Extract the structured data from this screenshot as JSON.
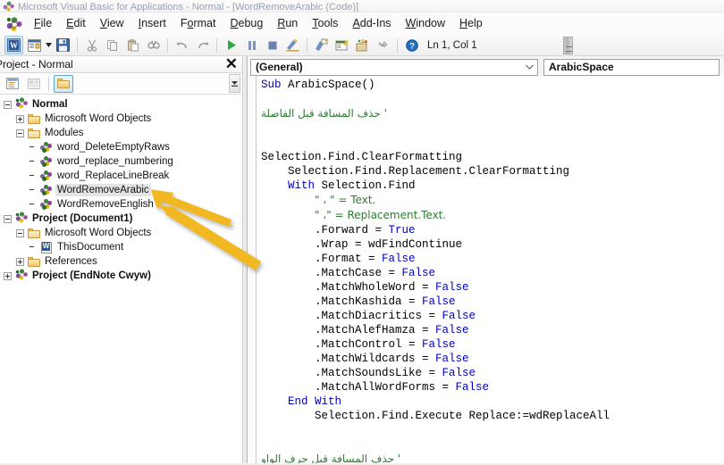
{
  "window": {
    "title": "Microsoft Visual Basic for Applications - Normal - [WordRemoveArabic (Code)]",
    "app_icon": "vba-logo-icon"
  },
  "menubar": {
    "items": [
      {
        "label": "File",
        "mnemonic": "F"
      },
      {
        "label": "Edit",
        "mnemonic": "E"
      },
      {
        "label": "View",
        "mnemonic": "V"
      },
      {
        "label": "Insert",
        "mnemonic": "I"
      },
      {
        "label": "Format",
        "mnemonic": "o"
      },
      {
        "label": "Debug",
        "mnemonic": "D"
      },
      {
        "label": "Run",
        "mnemonic": "R"
      },
      {
        "label": "Tools",
        "mnemonic": "T"
      },
      {
        "label": "Add-Ins",
        "mnemonic": "A"
      },
      {
        "label": "Window",
        "mnemonic": "W"
      },
      {
        "label": "Help",
        "mnemonic": "H"
      }
    ]
  },
  "toolbar": {
    "buttons": [
      "view-word-icon",
      "insert-userform-icon",
      "insert-dropdown-caret-icon",
      "save-icon",
      "cut-icon",
      "copy-icon",
      "paste-icon",
      "find-icon",
      "undo-icon",
      "redo-icon",
      "run-icon",
      "pause-icon",
      "stop-icon",
      "design-mode-icon",
      "project-explorer-icon",
      "properties-window-icon",
      "object-browser-icon",
      "toolbox-icon",
      "help-icon"
    ],
    "status_text": "Ln 1, Col 1"
  },
  "project_explorer": {
    "title": "Project - Normal",
    "close_label": "✕",
    "toolbar_buttons": [
      "view-code-icon",
      "view-object-icon",
      "toggle-folders-icon"
    ],
    "tree": [
      {
        "label": "Normal",
        "icon": "project-icon",
        "depth": 0,
        "bold": true,
        "expander": "minus",
        "selected": false
      },
      {
        "label": "Microsoft Word Objects",
        "icon": "folder-icon",
        "depth": 1,
        "bold": false,
        "expander": "plus",
        "selected": false
      },
      {
        "label": "Modules",
        "icon": "folder-open-icon",
        "depth": 1,
        "bold": false,
        "expander": "minus",
        "selected": false
      },
      {
        "label": "word_DeleteEmptyRaws",
        "icon": "module-icon",
        "depth": 2,
        "bold": false,
        "expander": "none",
        "selected": false
      },
      {
        "label": "word_replace_numbering",
        "icon": "module-icon",
        "depth": 2,
        "bold": false,
        "expander": "none",
        "selected": false
      },
      {
        "label": "word_ReplaceLineBreak",
        "icon": "module-icon",
        "depth": 2,
        "bold": false,
        "expander": "none",
        "selected": false
      },
      {
        "label": "WordRemoveArabic",
        "icon": "module-icon",
        "depth": 2,
        "bold": false,
        "expander": "none",
        "selected": true
      },
      {
        "label": "WordRemoveEnglish",
        "icon": "module-icon",
        "depth": 2,
        "bold": false,
        "expander": "none",
        "selected": false
      },
      {
        "label": "Project (Document1)",
        "icon": "project-icon",
        "depth": 0,
        "bold": true,
        "expander": "minus",
        "selected": false
      },
      {
        "label": "Microsoft Word Objects",
        "icon": "folder-open-icon",
        "depth": 1,
        "bold": false,
        "expander": "minus",
        "selected": false
      },
      {
        "label": "ThisDocument",
        "icon": "word-document-icon",
        "depth": 2,
        "bold": false,
        "expander": "none",
        "selected": false
      },
      {
        "label": "References",
        "icon": "folder-icon",
        "depth": 1,
        "bold": false,
        "expander": "plus",
        "selected": false
      },
      {
        "label": "Project (EndNote Cwyw)",
        "icon": "project-icon",
        "depth": 0,
        "bold": true,
        "expander": "plus",
        "selected": false
      }
    ]
  },
  "code_pane": {
    "object_dropdown": "(General)",
    "procedure_dropdown": "ArabicSpace",
    "dropdown_arrow": "∨",
    "lines": [
      {
        "t": "kw",
        "text": "Sub "
      },
      {
        "t": "blank",
        "text": ""
      },
      {
        "t": "arabic-comment",
        "text": "' حذف المسافة قبل الفاصلة"
      },
      {
        "t": "blank",
        "text": ""
      },
      {
        "t": "blank",
        "text": ""
      },
      {
        "t": "plain",
        "text": "Selection.Find.ClearFormatting"
      },
      {
        "t": "plain",
        "text": "    Selection.Find.Replacement.ClearFormatting"
      }
    ],
    "code_lines": [
      "Sub ArabicSpace()",
      "",
      "' حذف المسافة قبل الفاصلة",
      "",
      "",
      "Selection.Find.ClearFormatting",
      "    Selection.Find.Replacement.ClearFormatting",
      "    With Selection.Find",
      "        .Text = \" ، \"",
      "        .Replacement.Text = \"، \"",
      "        .Forward = True",
      "        .Wrap = wdFindContinue",
      "        .Format = False",
      "        .MatchCase = False",
      "        .MatchWholeWord = False",
      "        .MatchKashida = False",
      "        .MatchDiacritics = False",
      "        .MatchAlefHamza = False",
      "        .MatchControl = False",
      "        .MatchWildcards = False",
      "        .MatchSoundsLike = False",
      "        .MatchAllWordForms = False",
      "    End With",
      "        Selection.Find.Execute Replace:=wdReplaceAll",
      "",
      "",
      "' حذف المسافة قبل حرف الواو"
    ],
    "keywords": [
      "Sub",
      "With",
      "End",
      "True",
      "False"
    ],
    "procedure_name": "ArabicSpace",
    "comments": [
      "' حذف المسافة قبل الفاصلة",
      "' حذف المسافة قبل حرف الواو"
    ]
  },
  "annotations": {
    "arrows": [
      {
        "name": "arrow-to-wordremovearabic",
        "color": "#F2B824"
      },
      {
        "name": "arrow-to-wordremoveenglish",
        "color": "#F2B824"
      }
    ]
  },
  "colors": {
    "keyword": "#0000C0",
    "comment": "#2E7D32",
    "selection": "#E4E4E4",
    "arrow": "#F2B824",
    "title_text": "#9AA0B4"
  }
}
